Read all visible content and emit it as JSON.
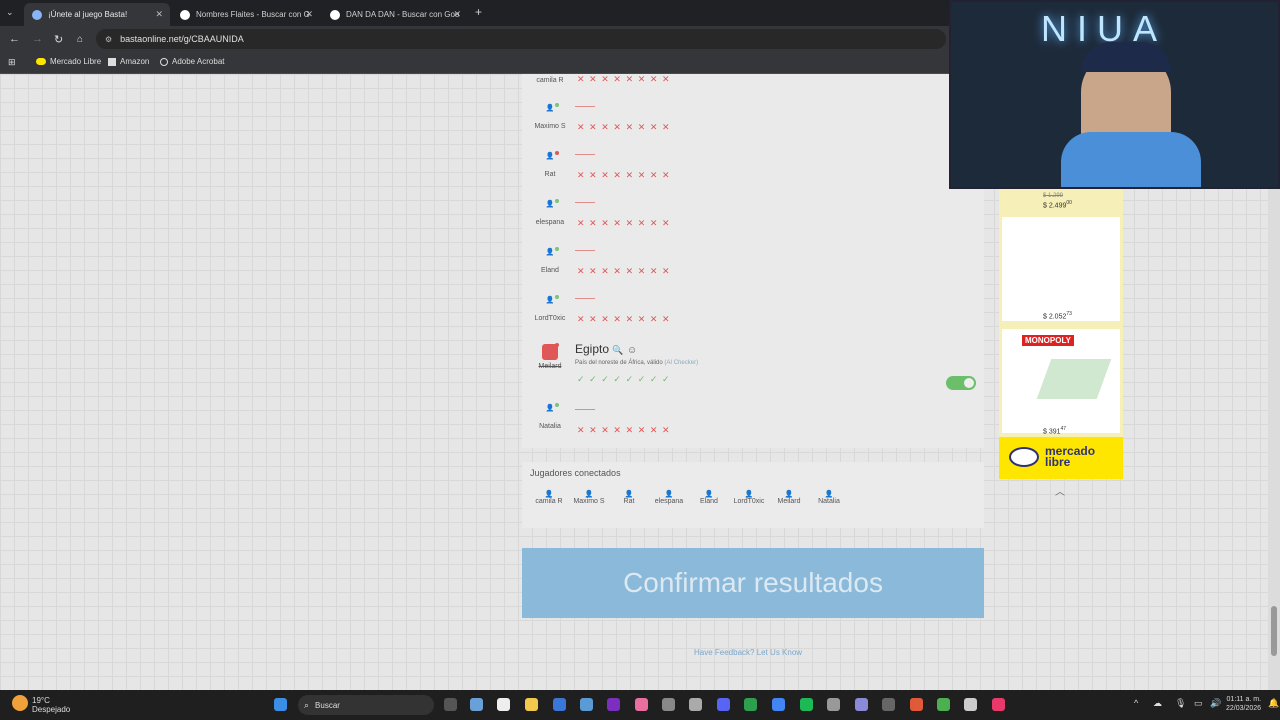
{
  "browser": {
    "tabs": [
      {
        "title": "¡Únete al juego Basta!",
        "active": true
      },
      {
        "title": "Nombres Flaites - Buscar con G"
      },
      {
        "title": "DAN DA DAN - Buscar con Goo"
      }
    ],
    "url": "bastaonline.net/g/CBAAUNIDA",
    "bookmarks": [
      "Mercado Libre",
      "Amazon",
      "Adobe Acrobat"
    ]
  },
  "players": [
    {
      "name": "camila R",
      "status": "green"
    },
    {
      "name": "Maximo S",
      "status": "green"
    },
    {
      "name": "Rat",
      "status": "red"
    },
    {
      "name": "elespana",
      "status": "green"
    },
    {
      "name": "Eland",
      "status": "green"
    },
    {
      "name": "LordT0xic",
      "status": "green"
    },
    {
      "name": "Meilard",
      "status": "red"
    },
    {
      "name": "Natalia",
      "status": "green"
    }
  ],
  "answer": {
    "word": "Egipto",
    "note": "País del noreste de África, válido",
    "checker": "(AI Checker)"
  },
  "connected_title": "Jugadores conectados",
  "confirm_label": "Confirmar resultados",
  "feedback_label": "Have Feedback? Let Us Know",
  "ads": {
    "prices": [
      "$ 2.499",
      "$ 2.052",
      "$ 391"
    ],
    "cents": [
      "00",
      "73",
      "47"
    ],
    "old_price": "$ 1.299",
    "monopoly": "MONOPOLY",
    "brand": "mercado libre"
  },
  "cam": {
    "sign": "NIUA"
  },
  "taskbar": {
    "weather_temp": "19°C",
    "weather_desc": "Despejado",
    "search": "Buscar",
    "time": "01:11 a. m.",
    "date": "22/03/2026"
  }
}
